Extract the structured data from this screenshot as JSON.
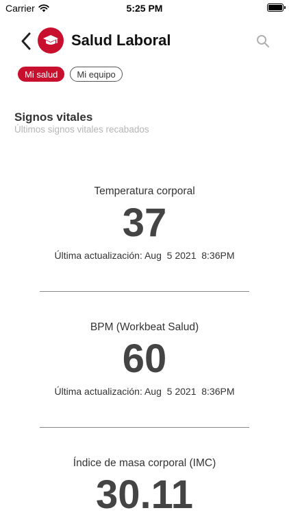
{
  "status": {
    "carrier": "Carrier",
    "time": "5:25 PM"
  },
  "header": {
    "title": "Salud Laboral"
  },
  "chips": [
    {
      "label": "Mi salud",
      "active": true
    },
    {
      "label": "Mi equipo",
      "active": false
    }
  ],
  "section": {
    "title": "Signos vitales",
    "subtitle": "Últimos signos vitales recabados"
  },
  "vitals": [
    {
      "label": "Temperatura corporal",
      "value": "37",
      "updated": "Última actualización: Aug  5 2021  8:36PM"
    },
    {
      "label": "BPM (Workbeat Salud)",
      "value": "60",
      "updated": "Última actualización: Aug  5 2021  8:36PM"
    },
    {
      "label": "Índice de masa corporal (IMC)",
      "value": "30.11"
    }
  ],
  "colors": {
    "brand": "#c8102e",
    "muted": "#b5b5b5"
  },
  "icons": [
    "wifi-icon",
    "battery-icon",
    "back-chevron-icon",
    "graduation-cap-icon",
    "search-icon"
  ]
}
